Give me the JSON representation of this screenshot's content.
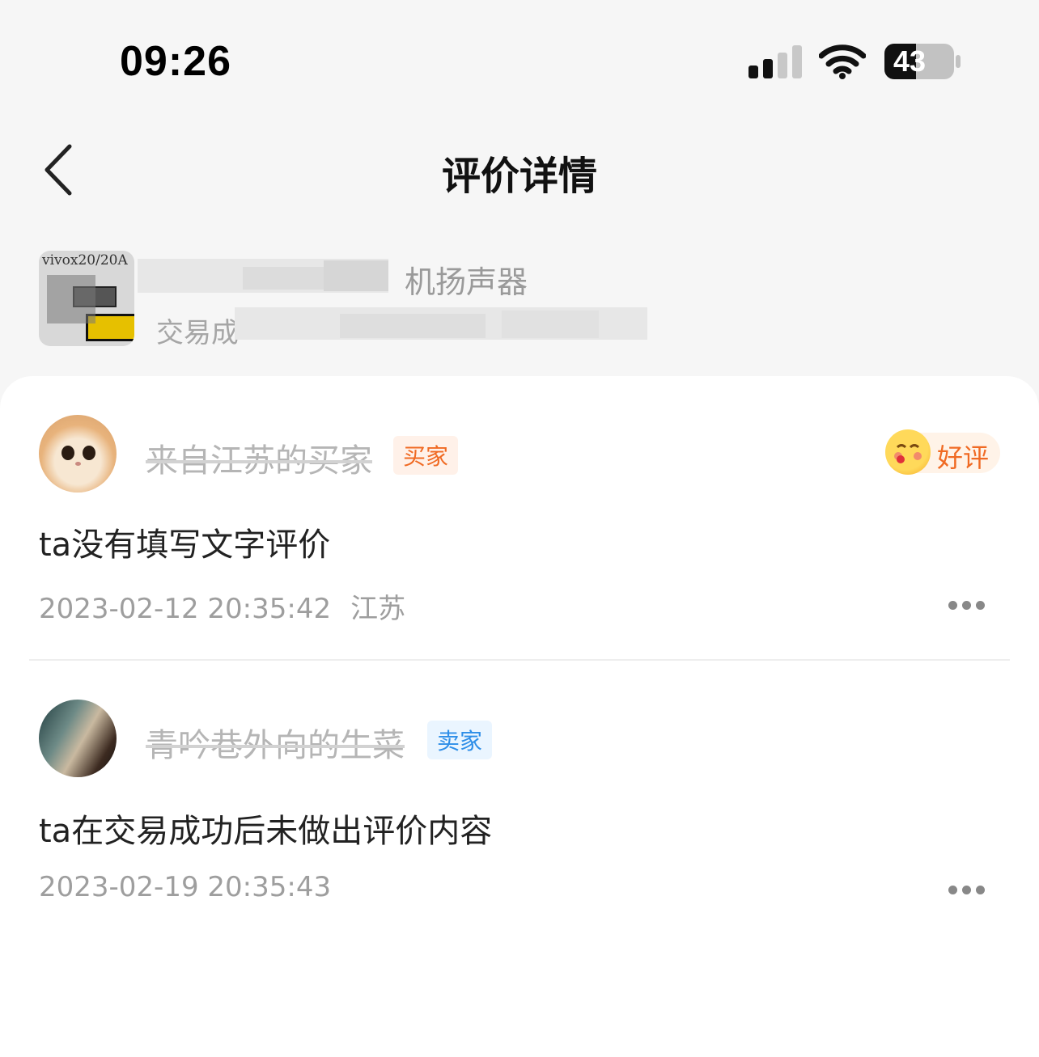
{
  "status_bar": {
    "time": "09:26",
    "battery": "43"
  },
  "nav": {
    "title": "评价详情"
  },
  "product": {
    "thumb_label": "vivox20/20A",
    "title_fragment": "机扬声器",
    "status_fragment": "交易成"
  },
  "reviews": [
    {
      "username": "来自江苏的买家",
      "role": "买家",
      "rating": "好评",
      "content": "ta没有填写文字评价",
      "timestamp": "2023-02-12 20:35:42",
      "region": "江苏"
    },
    {
      "username": "青吟巷外向的生菜",
      "role": "卖家",
      "content": "ta在交易成功后未做出评价内容",
      "timestamp": "2023-02-19 20:35:43"
    }
  ],
  "colors": {
    "buyer_tag": "#f06a23",
    "seller_tag": "#2e8ee8",
    "rating": "#f06a23",
    "background": "#f6f6f6"
  },
  "icons": [
    "back-arrow-icon",
    "cellular-signal-icon",
    "wifi-icon",
    "battery-icon",
    "smile-face-icon",
    "more-dots-icon"
  ]
}
